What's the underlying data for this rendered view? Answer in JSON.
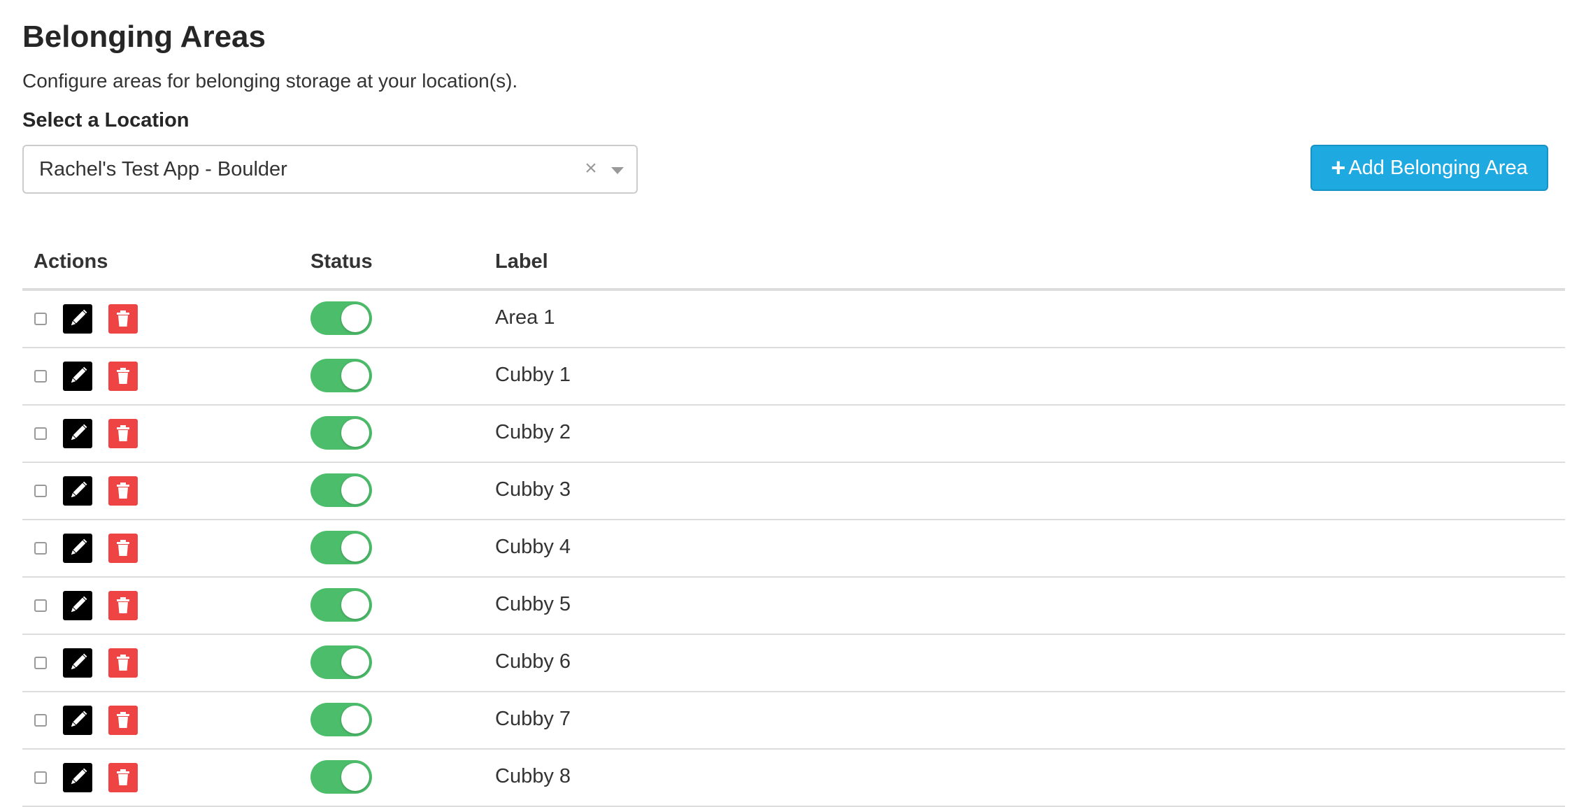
{
  "page": {
    "title": "Belonging Areas",
    "subtitle": "Configure areas for belonging storage at your location(s)."
  },
  "location_select": {
    "label": "Select a Location",
    "value": "Rachel's Test App - Boulder",
    "clear_glyph": "×"
  },
  "add_button": {
    "icon": "plus-icon",
    "icon_glyph": "+",
    "label": "Add Belonging Area",
    "color": "#1fa9e1"
  },
  "table": {
    "columns": {
      "actions": "Actions",
      "status": "Status",
      "label": "Label"
    },
    "rows": [
      {
        "label": "Area 1",
        "enabled": true,
        "selected": false
      },
      {
        "label": "Cubby 1",
        "enabled": true,
        "selected": false
      },
      {
        "label": "Cubby 2",
        "enabled": true,
        "selected": false
      },
      {
        "label": "Cubby 3",
        "enabled": true,
        "selected": false
      },
      {
        "label": "Cubby 4",
        "enabled": true,
        "selected": false
      },
      {
        "label": "Cubby 5",
        "enabled": true,
        "selected": false
      },
      {
        "label": "Cubby 6",
        "enabled": true,
        "selected": false
      },
      {
        "label": "Cubby 7",
        "enabled": true,
        "selected": false
      },
      {
        "label": "Cubby 8",
        "enabled": true,
        "selected": false
      }
    ]
  },
  "icons": {
    "edit": "pencil-icon",
    "delete": "trash-icon"
  },
  "colors": {
    "edit_button": "#000000",
    "delete_button": "#ef4444",
    "toggle_on": "#4cbd6a"
  }
}
